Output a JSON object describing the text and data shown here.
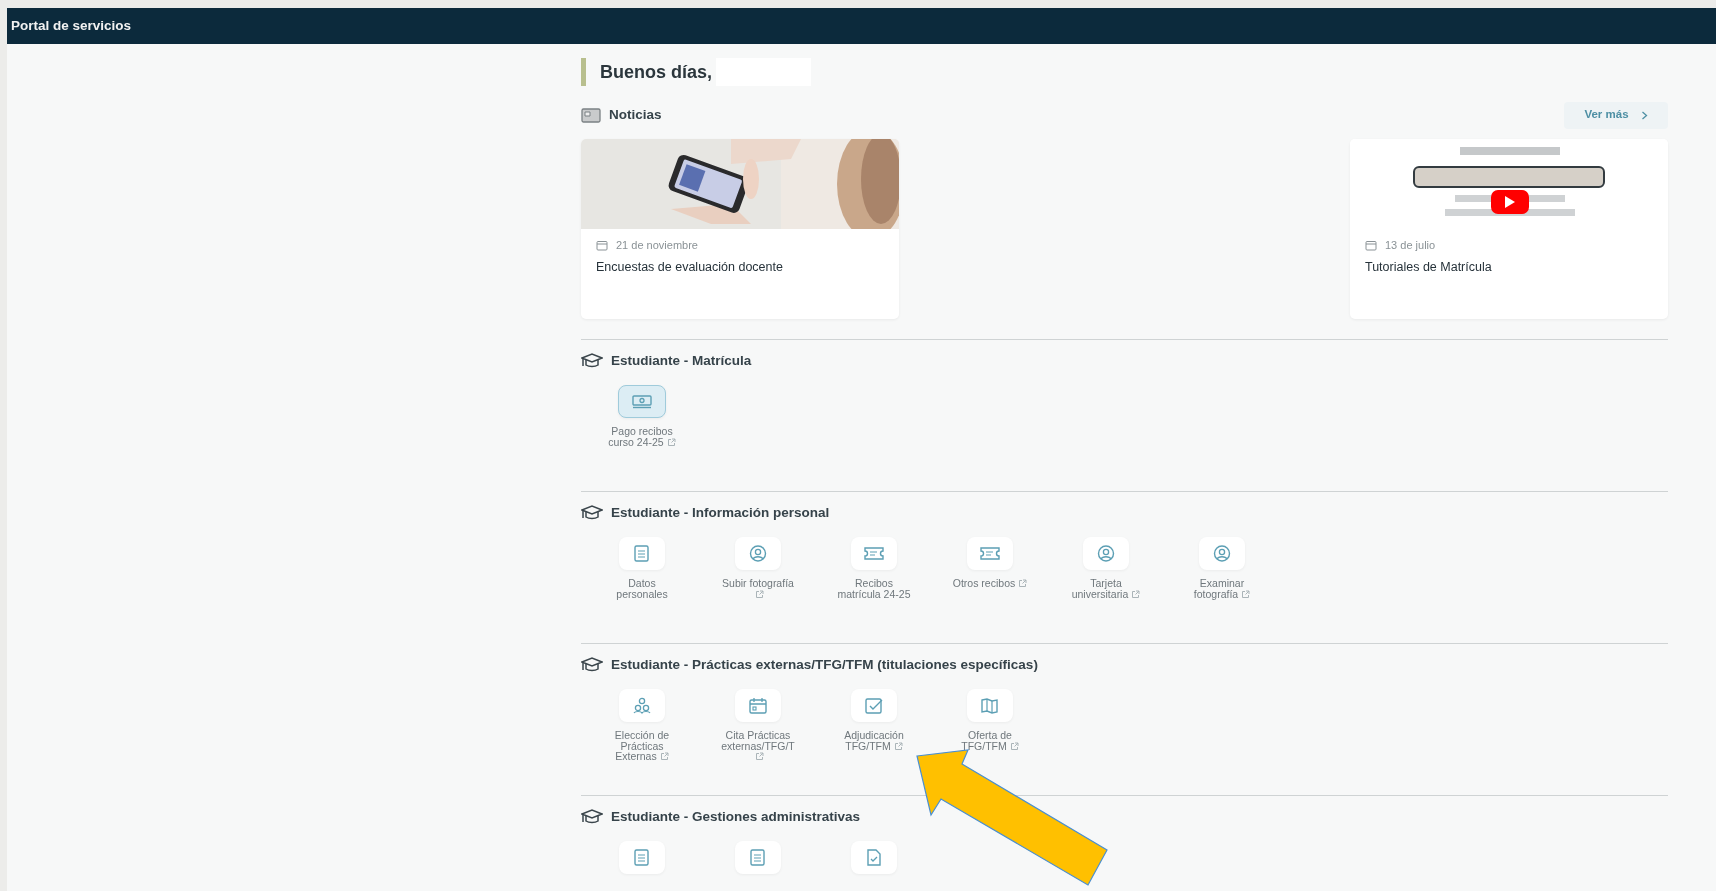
{
  "header": {
    "title": "Portal de servicios"
  },
  "greeting": {
    "text": "Buenos días,"
  },
  "news": {
    "title": "Noticias",
    "more_button": "Ver más",
    "items": [
      {
        "date": "21 de noviembre",
        "title": "Encuestas de evaluación docente"
      },
      {
        "kind": "video",
        "date": "13 de julio",
        "title": "Tutoriales de Matrícula"
      }
    ]
  },
  "sections": [
    {
      "title": "Estudiante - Matrícula",
      "services": [
        {
          "kind": "banknote",
          "label": "Pago recibos\ncurso 24-25",
          "external": true,
          "selected": true
        }
      ]
    },
    {
      "title": "Estudiante - Información personal",
      "services": [
        {
          "kind": "document",
          "label": "Datos\npersonales",
          "external": false,
          "selected": false
        },
        {
          "kind": "user",
          "label": "Subir fotografía\n",
          "external": true,
          "selected": false
        },
        {
          "kind": "ticket",
          "label": "Recibos\nmatrícula 24-25",
          "external": false,
          "selected": false
        },
        {
          "kind": "ticket",
          "label": "Otros recibos",
          "external": true,
          "selected": false
        },
        {
          "kind": "user",
          "label": "Tarjeta\nuniversitaria",
          "external": true,
          "selected": false
        },
        {
          "kind": "user",
          "label": "Examinar\nfotografía",
          "external": true,
          "selected": false
        }
      ]
    },
    {
      "title": "Estudiante - Prácticas externas/TFG/TFM (titulaciones específicas)",
      "services": [
        {
          "kind": "group",
          "label": "Elección de\nPrácticas\nExternas",
          "external": true,
          "selected": false
        },
        {
          "kind": "calendar",
          "label": "Cita Prácticas\nexternas/TFG/T\n",
          "external": true,
          "selected": false
        },
        {
          "kind": "check",
          "label": "Adjudicación\nTFG/TFM",
          "external": true,
          "selected": false
        },
        {
          "kind": "map",
          "label": "Oferta de\nTFG/TFM",
          "external": true,
          "selected": false
        }
      ]
    },
    {
      "title": "Estudiante - Gestiones administrativas",
      "services": [
        {
          "kind": "document",
          "selected": false
        },
        {
          "kind": "document",
          "selected": false
        },
        {
          "kind": "file",
          "selected": false
        }
      ]
    }
  ]
}
